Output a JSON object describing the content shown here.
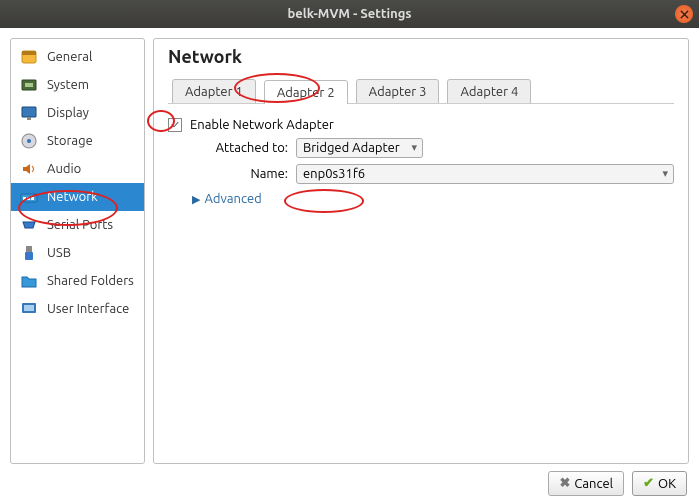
{
  "window": {
    "title": "belk-MVM - Settings"
  },
  "sidebar": {
    "items": [
      {
        "label": "General"
      },
      {
        "label": "System"
      },
      {
        "label": "Display"
      },
      {
        "label": "Storage"
      },
      {
        "label": "Audio"
      },
      {
        "label": "Network"
      },
      {
        "label": "Serial Ports"
      },
      {
        "label": "USB"
      },
      {
        "label": "Shared Folders"
      },
      {
        "label": "User Interface"
      }
    ]
  },
  "panel": {
    "heading": "Network",
    "tabs": [
      {
        "label": "Adapter 1"
      },
      {
        "label": "Adapter 2"
      },
      {
        "label": "Adapter 3"
      },
      {
        "label": "Adapter 4"
      }
    ],
    "enable_label": "Enable Network Adapter",
    "attached_label": "Attached to:",
    "attached_value": "Bridged Adapter",
    "name_label": "Name:",
    "name_value": "enp0s31f6",
    "advanced_label": "Advanced"
  },
  "footer": {
    "cancel": "Cancel",
    "ok": "OK"
  }
}
